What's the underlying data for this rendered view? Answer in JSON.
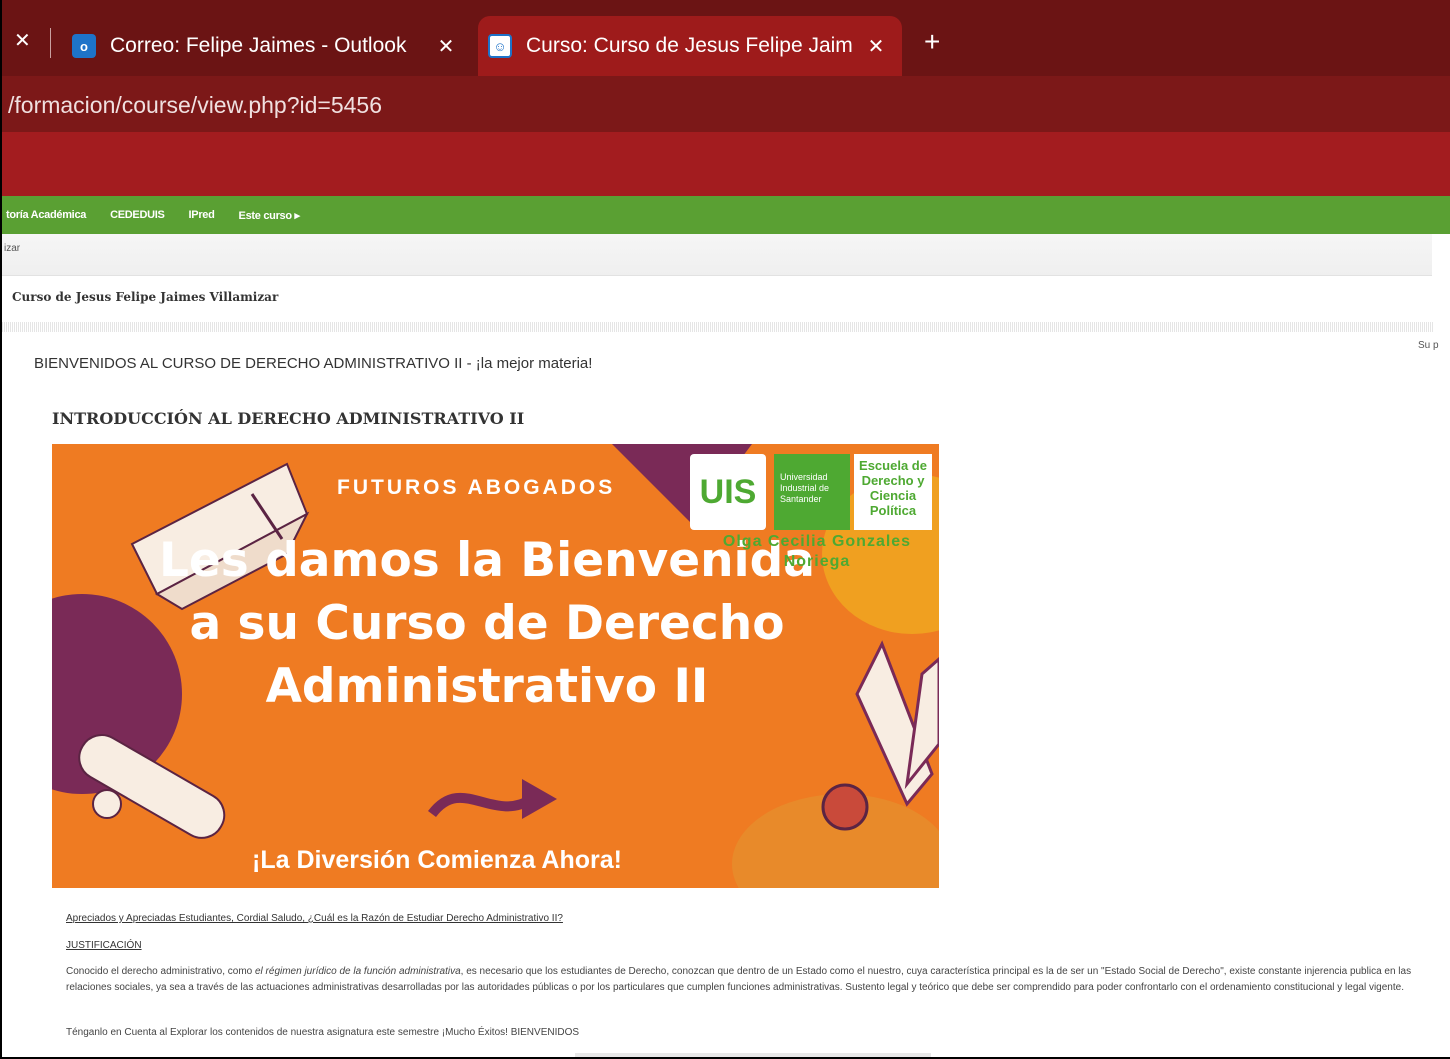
{
  "browser": {
    "tabs": [
      {
        "title": "Correo: Felipe Jaimes - Outlook",
        "icon": "outlook-icon",
        "active": false
      },
      {
        "title": "Curso: Curso de Jesus Felipe Jaim",
        "icon": "moodle-icon",
        "active": true
      }
    ],
    "close_glyph": "✕",
    "new_tab_glyph": "+",
    "url": "/formacion/course/view.php?id=5456"
  },
  "nav": {
    "items": [
      "toría Académica",
      "CEDEDUIS",
      "IPred",
      "Este curso ▸"
    ]
  },
  "strip_text": "izar",
  "course": {
    "heading": "Curso de Jesus Felipe Jaimes Villamizar",
    "side_snippet": "Su p",
    "welcome": "BIENVENIDOS AL CURSO DE DERECHO ADMINISTRATIVO II - ¡la mejor materia!",
    "section_title": "INTRODUCCIÓN AL DERECHO ADMINISTRATIVO II"
  },
  "banner": {
    "kicker": "FUTUROS ABOGADOS",
    "title": "Les damos la Bienvenida a su Curso de Derecho Administrativo II",
    "footer": "¡La Diversión Comienza Ahora!",
    "uis_logo": "UIS",
    "university": "Universidad Industrial de Santander",
    "school": "Escuela de Derecho y Ciencia Política",
    "professor": "Olga Cecilia Gonzales Noriega",
    "colors": {
      "background": "#ef7b22",
      "purple": "#7a2a57",
      "green": "#4ea932"
    }
  },
  "content": {
    "question": "Apreciados y Apreciadas Estudiantes, Cordial Saludo, ¿Cuál es la Razón de Estudiar Derecho Administrativo II?",
    "justification_label": "JUSTIFICACIÓN",
    "justification_before": "Conocido el derecho administrativo, como ",
    "justification_em": "el régimen jurídico de la función administrativa",
    "justification_after": ", es necesario que los estudiantes de Derecho, conozcan que dentro de un Estado como el nuestro, cuya característica principal es la de ser un \"Estado Social de Derecho\", existe constante injerencia publica en las relaciones sociales, ya sea a través de las actuaciones administrativas desarrolladas por las autoridades públicas o por los particulares que cumplen funciones administrativas. Sustento legal y teórico que debe ser comprendido para poder confrontarlo con el ordenamiento constitucional y legal vigente.",
    "closing": "Ténganlo en Cuenta al Explorar los contenidos de nuestra asignatura este semestre ¡Mucho Éxitos! BIENVENIDOS"
  }
}
